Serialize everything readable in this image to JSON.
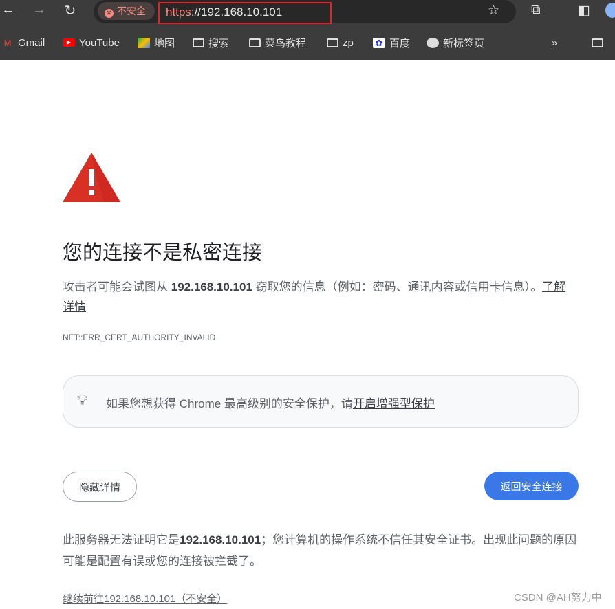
{
  "browser": {
    "security_chip": "不安全",
    "url_scheme": "https",
    "url_rest": "://192.168.10.101",
    "bookmarks": [
      {
        "label": "Gmail",
        "icon": "gmail-icon"
      },
      {
        "label": "YouTube",
        "icon": "youtube-icon"
      },
      {
        "label": "地图",
        "icon": "maps-icon"
      },
      {
        "label": "搜索",
        "icon": "folder-icon"
      },
      {
        "label": "菜鸟教程",
        "icon": "folder-icon"
      },
      {
        "label": "zp",
        "icon": "folder-icon"
      },
      {
        "label": "百度",
        "icon": "baidu-icon"
      },
      {
        "label": "新标签页",
        "icon": "globe-icon"
      }
    ],
    "more": "»"
  },
  "page": {
    "title": "您的连接不是私密连接",
    "desc_pre": "攻击者可能会试图从 ",
    "desc_host": "192.168.10.101",
    "desc_post": " 窃取您的信息（例如：密码、通讯内容或信用卡信息）。",
    "learn_more": "了解详情",
    "error_code": "NET::ERR_CERT_AUTHORITY_INVALID",
    "card_text": "如果您想获得 Chrome 最高级别的安全保护，请",
    "card_link": "开启增强型保护",
    "hide_details": "隐藏详情",
    "back_safe": "返回安全连接",
    "exp_pre": "此服务器无法证明它是",
    "exp_host": "192.168.10.101",
    "exp_post": "；您计算机的操作系统不信任其安全证书。出现此问题的原因可能是配置有误或您的连接被拦截了。",
    "proceed": "继续前往192.168.10.101（不安全）",
    "watermark": "CSDN @AH努力中"
  },
  "colors": {
    "accent": "#3b78e7",
    "warning": "#d93025",
    "highlight_box": "#e0242b"
  }
}
